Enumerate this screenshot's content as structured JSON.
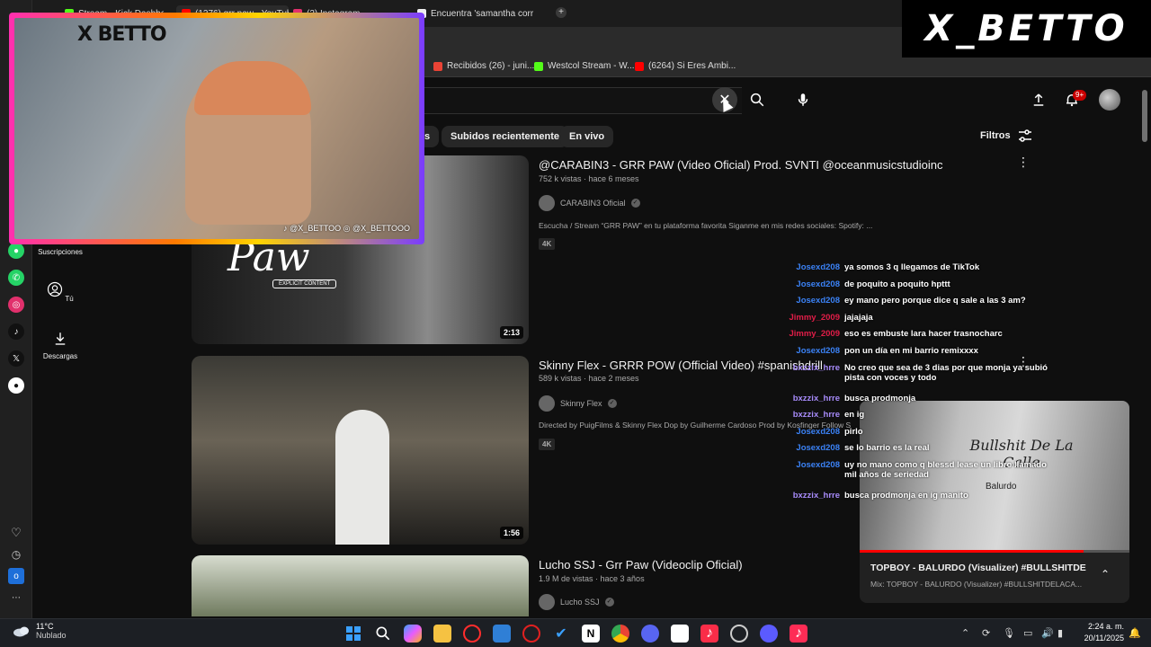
{
  "browser": {
    "tabs": [
      {
        "label": "Stream - Kick Dashboard",
        "color": "#53fc18"
      },
      {
        "label": "(1276) grr paw - YouTube",
        "color": "#ff0000"
      },
      {
        "label": "(2) Instagram",
        "color": "#e1306c"
      },
      {
        "label": "Encuentra 'samantha corr",
        "color": "#ffffff"
      }
    ],
    "new_tab": "+",
    "bookmarks": [
      {
        "label": "Recibidos (26) - juni...",
        "color": "#ea4335"
      },
      {
        "label": "Westcol Stream - W...",
        "color": "#53fc18"
      },
      {
        "label": "(6264) Si Eres Ambi...",
        "color": "#ff0000"
      }
    ]
  },
  "webcam": {
    "logo": "X BETTO",
    "handles": "♪ @X_BETTOO  ◎ @X_BETTOOO"
  },
  "brand_logo": "X_BETTO",
  "masthead": {
    "clear_symbol": "✕",
    "notifications_badge": "9+"
  },
  "chips": [
    "s",
    "Subidos recientemente",
    "En vivo"
  ],
  "filters_label": "Filtros",
  "guide": [
    {
      "label": "Suscripciones",
      "icon": "subscriptions-icon"
    },
    {
      "label": "Tú",
      "icon": "person-icon"
    },
    {
      "label": "Descargas",
      "icon": "download-icon"
    }
  ],
  "results": [
    {
      "title": "@CARABIN3 - GRR PAW (Video Oficial) Prod. SVNTI @oceanmusicstudioinc",
      "meta": "752 k vistas · hace 6 meses",
      "channel": "CARABIN3 Oficial",
      "description": "Escucha / Stream “GRR PAW” en tu plataforma favorita Siganme en mis redes sociales: Spotify: ...",
      "badge": "4K",
      "duration": "2:13",
      "thumb_text": "Paw",
      "thumb_tag": "EXPLICIT CONTENT"
    },
    {
      "title": "Skinny Flex - GRRR POW (Official Video) #spanishdrill",
      "meta": "589 k vistas · hace 2 meses",
      "channel": "Skinny Flex",
      "description": "Directed by PuigFilms & Skinny Flex Dop by Guilherme Cardoso Prod by Kosfinger Follow S",
      "badge": "4K",
      "duration": "1:56"
    },
    {
      "title": "Lucho SSJ - Grr Paw (Videoclip Oficial)",
      "meta": "1.9 M de vistas · hace 3 años",
      "channel": "Lucho SSJ"
    }
  ],
  "chat": [
    {
      "user": "Josexd208",
      "text": "ya somos 3 q llegamos de TikTok",
      "color": "#3b82f6",
      "lines": 1
    },
    {
      "user": "Josexd208",
      "text": "de poquito a poquito hpttt",
      "color": "#3b82f6",
      "lines": 1
    },
    {
      "user": "Josexd208",
      "text": "ey mano pero porque dice q sale a las 3 am?",
      "color": "#3b82f6",
      "lines": 1
    },
    {
      "user": "Jimmy_2009",
      "text": "jajajaja",
      "color": "#e11d48",
      "lines": 1
    },
    {
      "user": "Jimmy_2009",
      "text": "eso es embuste lara hacer trasnocharc",
      "color": "#e11d48",
      "lines": 1
    },
    {
      "user": "Josexd208",
      "text": "pon un día en mi barrio remixxxx",
      "color": "#3b82f6",
      "lines": 1
    },
    {
      "user": "bxzzix_hrre",
      "text": "No creo que sea de 3 dias por que monja ya subió pista con voces y todo",
      "color": "#a78bfa",
      "lines": 2
    },
    {
      "user": "bxzzix_hrre",
      "text": "busca prodmonja",
      "color": "#a78bfa",
      "lines": 1
    },
    {
      "user": "bxzzix_hrre",
      "text": "en ig",
      "color": "#a78bfa",
      "lines": 1
    },
    {
      "user": "Josexd208",
      "text": "pirlo",
      "color": "#3b82f6",
      "lines": 1
    },
    {
      "user": "Josexd208",
      "text": "se lo barrio es la real",
      "color": "#3b82f6",
      "lines": 1
    },
    {
      "user": "Josexd208",
      "text": "uy no mano como q blessd lease un libro llamado mil años de seriedad",
      "color": "#3b82f6",
      "lines": 2
    },
    {
      "user": "bxzzix_hrre",
      "text": "busca prodmonja en ig manito",
      "color": "#a78bfa",
      "lines": 1
    }
  ],
  "miniplayer": {
    "title": "TOPBOY - BALURDO (Visualizer) #BULLSHITDEL...",
    "subtitle": "Mix: TOPBOY - BALURDO (Visualizer) #BULLSHITDELACA...",
    "art_text": "Bullshit De La Calle",
    "art_sub": "Balurdo",
    "progress": 0.83
  },
  "taskbar": {
    "weather_temp": "11°C",
    "weather_desc": "Nublado",
    "time": "2:24 a. m.",
    "date": "20/11/2025"
  },
  "colors": {
    "youtube_bg": "#0f0f0f",
    "chip_bg": "#272727",
    "accent_red": "#ff0000"
  }
}
